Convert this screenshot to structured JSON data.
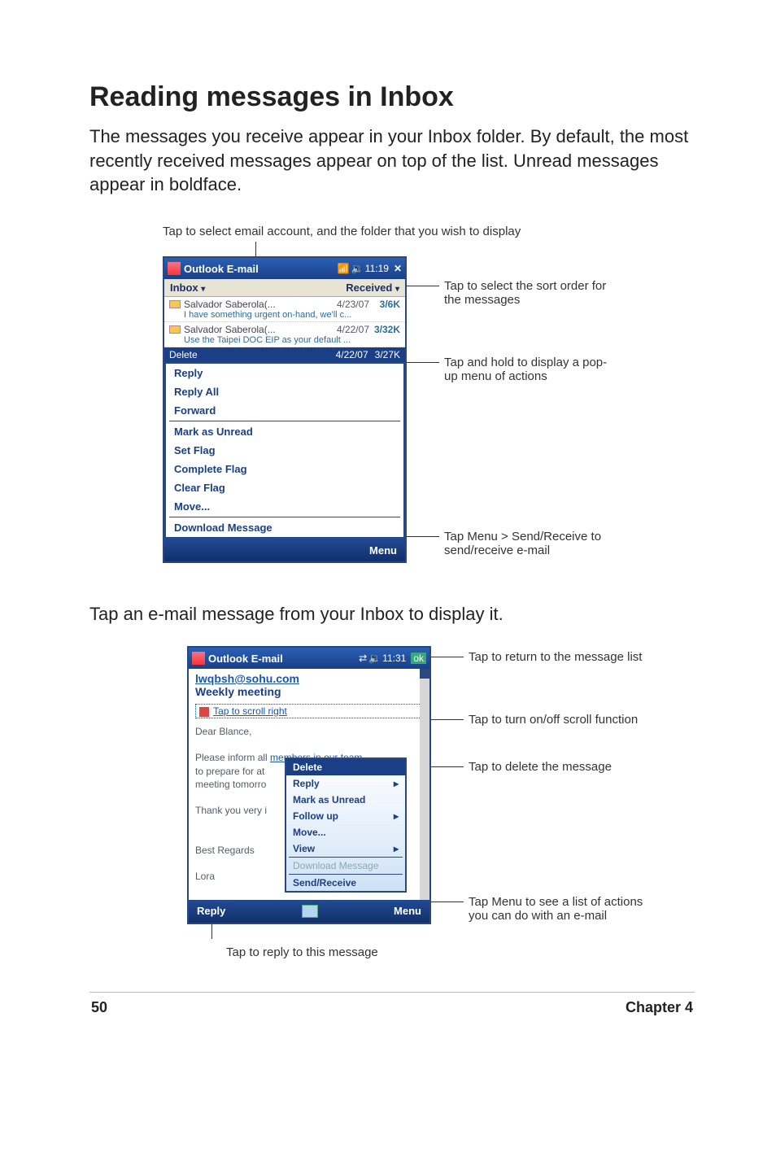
{
  "heading": "Reading messages in Inbox",
  "intro": "The messages you receive appear in your Inbox folder. By default, the most recently received messages appear on top of the list. Unread messages appear in boldface.",
  "caption1": "Tap to select email account, and the folder that you wish to display",
  "device1": {
    "title": "Outlook E-mail",
    "time": "11:19",
    "close": "✕",
    "folder": "Inbox",
    "sort": "Received",
    "messages": [
      {
        "sender": "Salvador Saberola(...",
        "date": "4/23/07",
        "size": "3/6K",
        "preview": "I have something urgent on-hand, we'll c..."
      },
      {
        "sender": "Salvador Saberola(...",
        "date": "4/22/07",
        "size": "3/32K",
        "preview": "Use the Taipei DOC EIP as your default ..."
      }
    ],
    "selected": {
      "label": "Delete",
      "date": "4/22/07",
      "size": "3/27K"
    },
    "ctx": [
      "Reply",
      "Reply All",
      "Forward",
      "Mark as Unread",
      "Set Flag",
      "Complete Flag",
      "Clear Flag",
      "Move...",
      "Download Message"
    ],
    "menu": "Menu"
  },
  "callouts1": {
    "c1": "Tap to select the sort order for the messages",
    "c2": "Tap and hold to display a pop-up menu of actions",
    "c3": "Tap Menu > Send/Receive to send/receive e-mail"
  },
  "body2": "Tap an e-mail message from your Inbox to display it.",
  "device2": {
    "title": "Outlook E-mail",
    "time": "11:31",
    "ok": "ok",
    "from": "lwqbsh@sohu.com",
    "subject": "Weekly meeting",
    "scrollnote": "Tap to scroll right",
    "greeting": "Dear Blance,",
    "para_pre": "Please inform all ",
    "para_hl": "members in our team",
    "para2": "to prepare for at",
    "para3": "meeting tomorro",
    "thank": "Thank you very i",
    "regards": "Best Regards",
    "sig": "Lora",
    "popup": [
      "Delete",
      "Reply",
      "Mark as Unread",
      "Follow up",
      "Move...",
      "View",
      "Download Message",
      "Send/Receive"
    ],
    "reply": "Reply",
    "menu": "Menu"
  },
  "callouts2": {
    "c1": "Tap to return to the message list",
    "c2": "Tap to turn on/off scroll function",
    "c3": "Tap to delete the message",
    "c4": "Tap Menu to see a list of actions you can do with an e-mail"
  },
  "caption2": "Tap to reply to this message",
  "footer": {
    "page": "50",
    "chapter": "Chapter 4"
  }
}
